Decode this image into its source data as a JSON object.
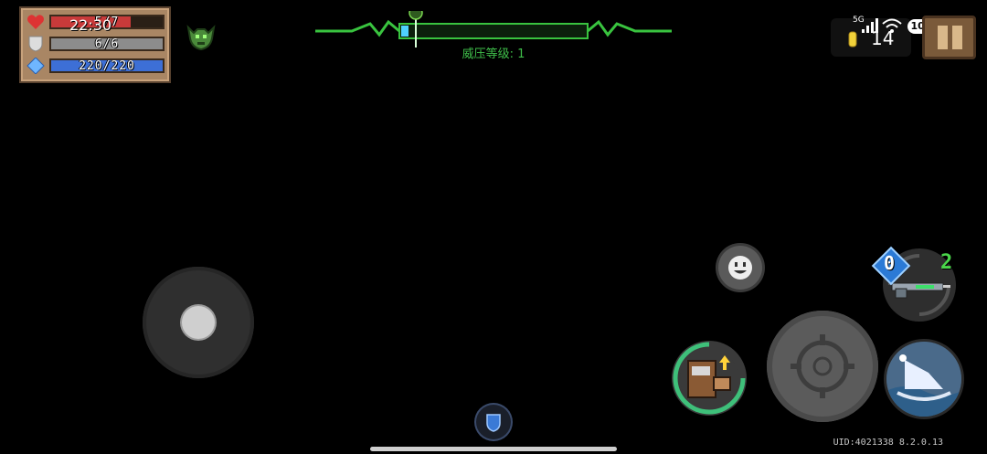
{
  "stats": {
    "hp": {
      "current": 5,
      "max": 7,
      "text": "5/7",
      "color": "#c83a3a"
    },
    "armor": {
      "current": 6,
      "max": 6,
      "text": "6/6",
      "color": "#8c8c8c"
    },
    "energy": {
      "current": 220,
      "max": 220,
      "text": "220/220",
      "color": "#3d6fd6"
    }
  },
  "overlay_clock": "22:30",
  "threat": {
    "label": "威压等级: 1"
  },
  "status": {
    "network": "5G",
    "coins": "14",
    "battery": "100"
  },
  "weapon": {
    "energy_cost": "0",
    "slot": "2"
  },
  "uid": "UID:4021338 8.2.0.13",
  "colors": {
    "accent_green": "#3fbf4a",
    "panel": "#a98664"
  }
}
